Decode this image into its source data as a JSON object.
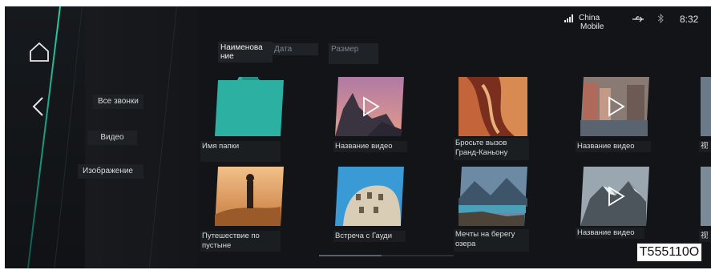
{
  "statusbar": {
    "carrier_line1": "China",
    "carrier_line2": "Mobile",
    "time": "8:32",
    "icons": [
      "signal-icon",
      "usb-icon",
      "bluetooth-icon"
    ]
  },
  "nav": {
    "categories": [
      "Все звонки",
      "Видео",
      "Изображение"
    ]
  },
  "sort": {
    "name_line1": "Наименова",
    "name_line2": "ние",
    "date": "Дата",
    "size": "Размер"
  },
  "grid": {
    "row1": [
      "Имя папки",
      "Название видео",
      "Бросьте вызов Гранд-Каньону",
      "Название видео",
      "视"
    ],
    "row2": [
      "Путешествие по пустыне",
      "Встреча с Гауди",
      "Мечты на берегу озера",
      "Название видео",
      "视"
    ]
  },
  "figure_code": "T555110O",
  "colors": {
    "accent": "#2fe3b6",
    "folder": "#2bb0a2",
    "background": "#121418"
  }
}
